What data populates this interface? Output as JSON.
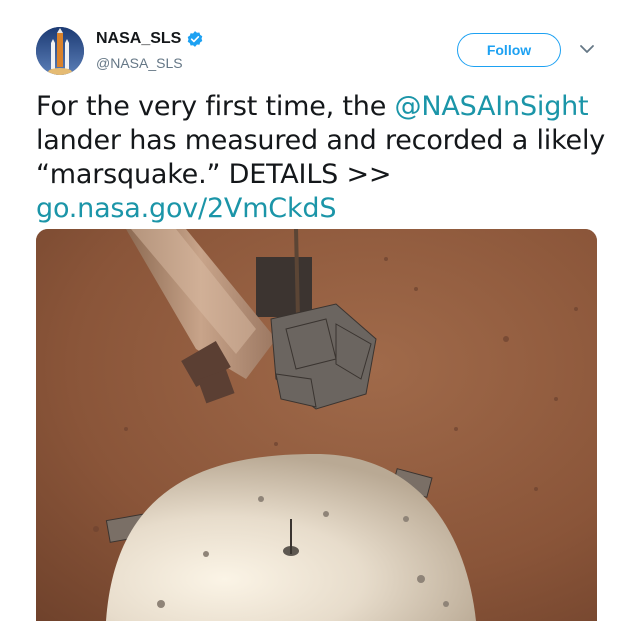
{
  "author": {
    "name": "NASA_SLS",
    "handle": "@NASA_SLS",
    "verified_icon": "verified-badge-icon",
    "avatar_icon": "rocket-avatar"
  },
  "actions": {
    "follow_label": "Follow",
    "more_icon": "chevron-down-icon"
  },
  "tweet": {
    "line1_prefix": "For the very first time, the ",
    "line1_mention": "@NASAInSight",
    "line2": "lander has measured and recorded a likely",
    "line3": "“marsquake.” DETAILS >>",
    "line4_link": "go.nasa.gov/2VmCkdS"
  },
  "media": {
    "kind": "photo",
    "subject": "InSight lander seismometer dome on Mars surface"
  },
  "colors": {
    "accent": "#1da1f2",
    "link": "#1b95a8",
    "text": "#14171a",
    "muted": "#657786"
  }
}
